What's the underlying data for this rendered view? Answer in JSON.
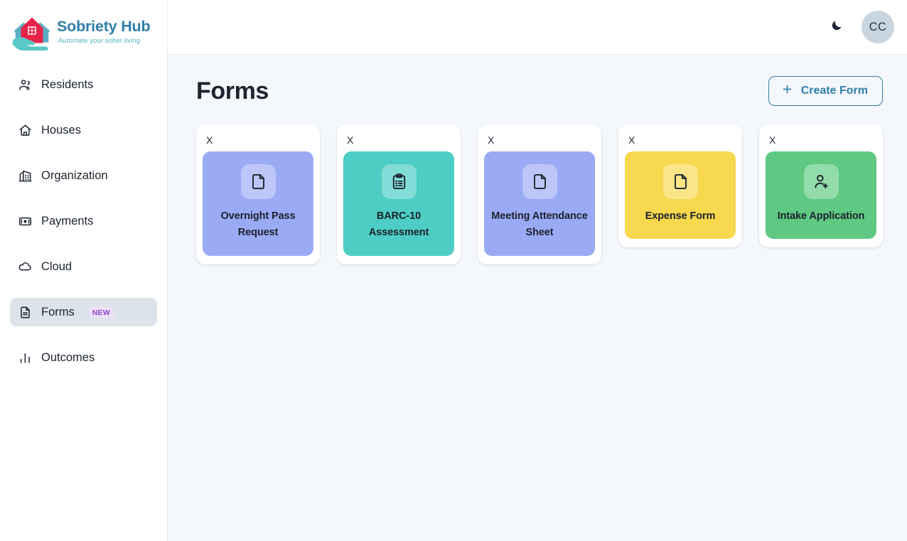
{
  "brand": {
    "title": "Sobriety Hub",
    "tagline": "Automate your sober living",
    "logo_icon": "hand-holding-houses-logo",
    "title_color": "#2F7FA8",
    "tagline_color": "#4FB3C4"
  },
  "sidebar": {
    "items": [
      {
        "label": "Residents",
        "icon": "users-icon",
        "active": false,
        "badge": ""
      },
      {
        "label": "Houses",
        "icon": "home-icon",
        "active": false,
        "badge": ""
      },
      {
        "label": "Organization",
        "icon": "building-icon",
        "active": false,
        "badge": ""
      },
      {
        "label": "Payments",
        "icon": "card-icon",
        "active": false,
        "badge": ""
      },
      {
        "label": "Cloud",
        "icon": "cloud-icon",
        "active": false,
        "badge": ""
      },
      {
        "label": "Forms",
        "icon": "file-text-icon",
        "active": true,
        "badge": "NEW"
      },
      {
        "label": "Outcomes",
        "icon": "bar-chart-icon",
        "active": false,
        "badge": ""
      }
    ],
    "active_bg": "#DDE3EA",
    "badge_bg": "#EFE0FB",
    "badge_color": "#8A44C8"
  },
  "topbar": {
    "theme_toggle_icon": "moon-icon",
    "avatar_initials": "CC",
    "avatar_bg": "#C9D5DF"
  },
  "page": {
    "title": "Forms",
    "create_button_label": "Create Form",
    "create_button_icon": "plus-icon",
    "accent_color": "#2F7FA8",
    "background": "#F4F7FB"
  },
  "forms": [
    {
      "name": "Overnight Pass Request",
      "icon": "document-icon",
      "tile_color": "#9BAAF5",
      "icon_bg": "#BCC6F8",
      "close_label": "X"
    },
    {
      "name": "BARC-10 Assessment",
      "icon": "clipboard-list-icon",
      "tile_color": "#4ECDC4",
      "icon_bg": "#81DDD6",
      "close_label": "X"
    },
    {
      "name": "Meeting Attendance Sheet",
      "icon": "document-icon",
      "tile_color": "#9BAAF5",
      "icon_bg": "#BCC6F8",
      "close_label": "X"
    },
    {
      "name": "Expense Form",
      "icon": "document-icon",
      "tile_color": "#F7D84E",
      "icon_bg": "#FAE687",
      "close_label": "X"
    },
    {
      "name": "Intake Application",
      "icon": "user-plus-icon",
      "tile_color": "#5FC983",
      "icon_bg": "#92DCAB",
      "close_label": "X"
    }
  ]
}
